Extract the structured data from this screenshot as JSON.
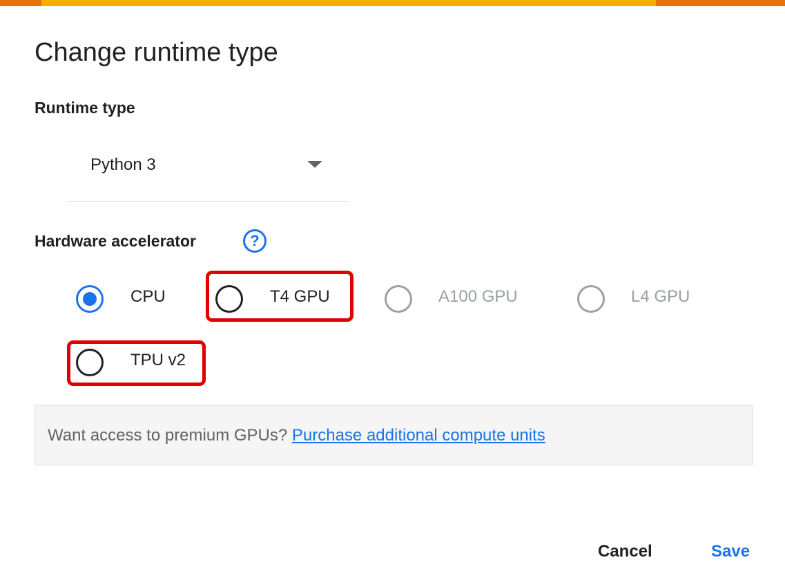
{
  "dialog": {
    "title": "Change runtime type"
  },
  "runtime_type": {
    "label": "Runtime type",
    "selected": "Python 3"
  },
  "hardware_accelerator": {
    "label": "Hardware accelerator",
    "help_glyph": "?",
    "selected": "CPU",
    "options": [
      {
        "label": "CPU",
        "enabled": true,
        "selected": true
      },
      {
        "label": "T4 GPU",
        "enabled": true,
        "selected": false,
        "highlighted": true
      },
      {
        "label": "A100 GPU",
        "enabled": false,
        "selected": false
      },
      {
        "label": "L4 GPU",
        "enabled": false,
        "selected": false
      },
      {
        "label": "TPU v2",
        "enabled": true,
        "selected": false,
        "highlighted": true
      }
    ]
  },
  "info": {
    "text": "Want access to premium GPUs?",
    "link_text": "Purchase additional compute units"
  },
  "buttons": {
    "cancel": "Cancel",
    "save": "Save"
  },
  "colors": {
    "accent": "#1a73e8",
    "highlight": "#e00000",
    "top_bar": "#f9ab00",
    "top_bar_edge": "#e8710a",
    "disabled": "#9aa0a6"
  },
  "icons": {
    "help": "help-circle-icon",
    "dropdown": "dropdown-arrow-icon"
  }
}
